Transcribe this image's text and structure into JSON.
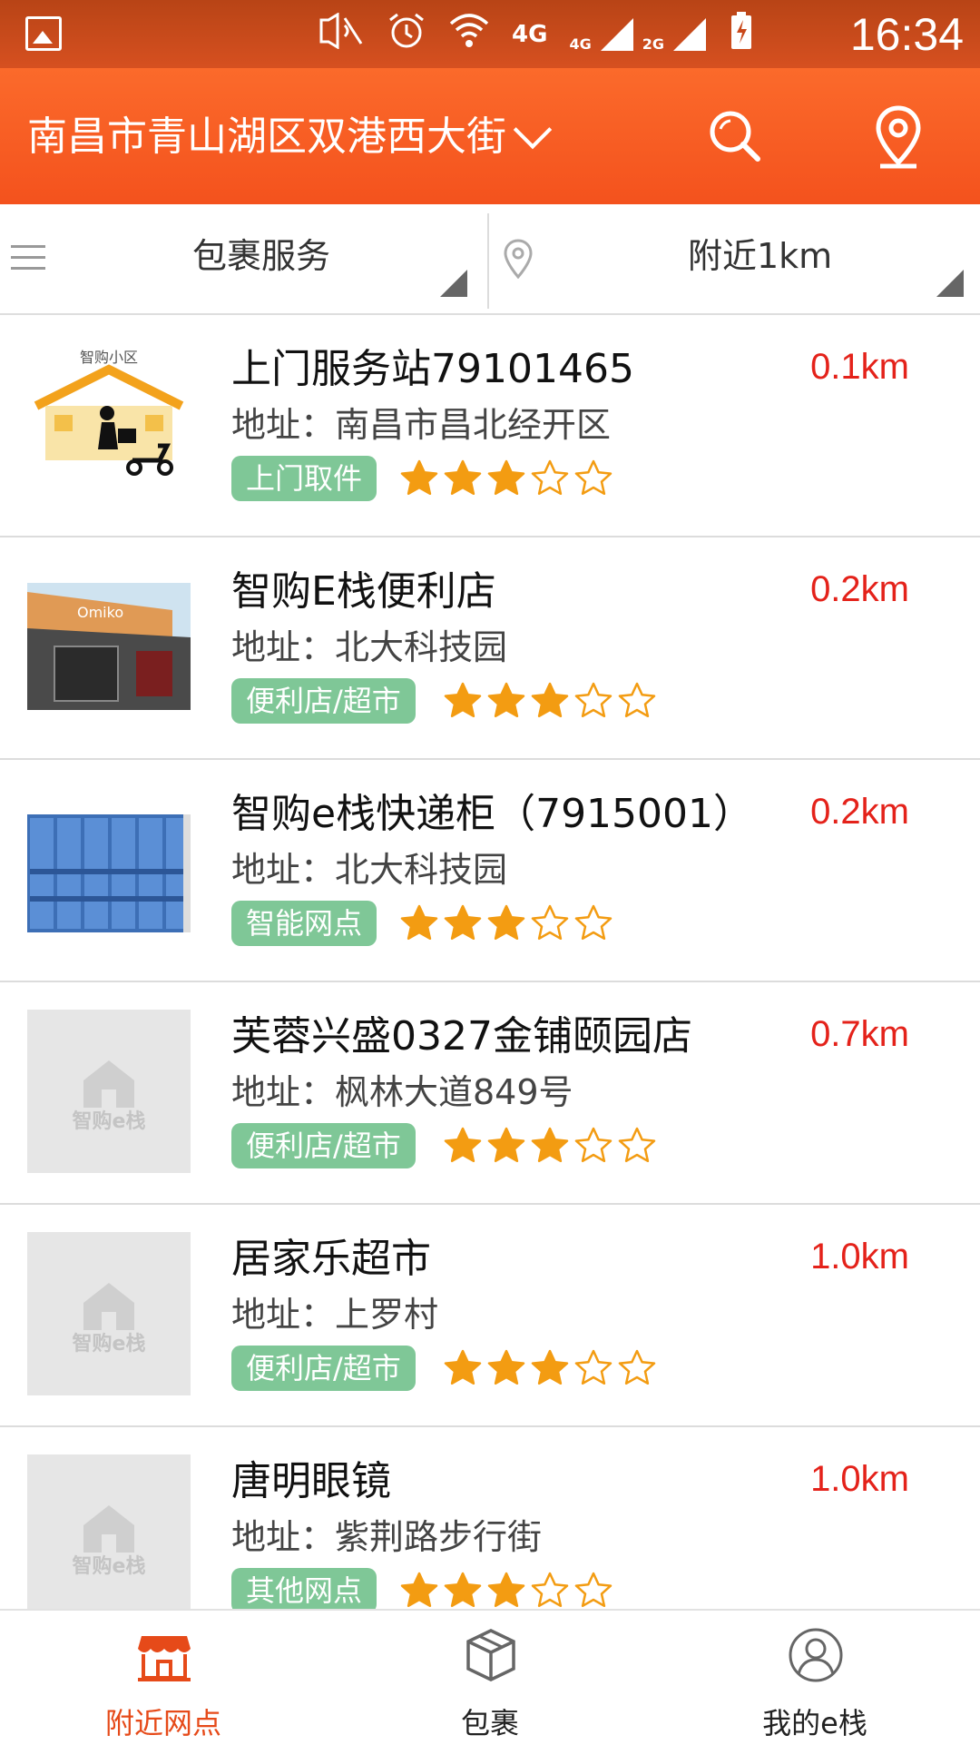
{
  "status_bar": {
    "time": "16:34",
    "network_1": "4G",
    "network_2": "4G",
    "network_3": "2G",
    "icons": [
      "image-icon",
      "mute-icon",
      "alarm-icon",
      "wifi-icon",
      "signal-icon",
      "battery-charging-icon"
    ]
  },
  "header": {
    "location": "南昌市青山湖区双港西大街",
    "accent_color": "#f75a22"
  },
  "filters": {
    "service_label": "包裹服务",
    "distance_label": "附近1km"
  },
  "stations": [
    {
      "name": "上门服务站79101465",
      "distance": "0.1km",
      "address": "地址：南昌市昌北经开区",
      "tag": "上门取件",
      "rating": 3,
      "thumb": "delivery-house-image",
      "thumb_caption": "智购小区"
    },
    {
      "name": "智购E栈便利店",
      "distance": "0.2km",
      "address": "地址：北大科技园",
      "tag": "便利店/超市",
      "rating": 3,
      "thumb": "storefront-image"
    },
    {
      "name": "智购e栈快递柜（7915001）",
      "distance": "0.2km",
      "address": "地址：北大科技园",
      "tag": "智能网点",
      "rating": 3,
      "thumb": "locker-image"
    },
    {
      "name": "芙蓉兴盛0327金铺颐园店",
      "distance": "0.7km",
      "address": "地址：枫林大道849号",
      "tag": "便利店/超市",
      "rating": 3,
      "thumb": "placeholder-logo",
      "thumb_caption": "智购e栈"
    },
    {
      "name": "居家乐超市",
      "distance": "1.0km",
      "address": "地址：上罗村",
      "tag": "便利店/超市",
      "rating": 3,
      "thumb": "placeholder-logo",
      "thumb_caption": "智购e栈"
    },
    {
      "name": "唐明眼镜",
      "distance": "1.0km",
      "address": "地址：紫荆路步行街",
      "tag": "其他网点",
      "rating": 3,
      "thumb": "placeholder-logo",
      "thumb_caption": "智购e栈"
    }
  ],
  "tabs": [
    {
      "label": "附近网点",
      "icon": "shop-icon",
      "active": true
    },
    {
      "label": "包裹",
      "icon": "package-icon",
      "active": false
    },
    {
      "label": "我的e栈",
      "icon": "user-icon",
      "active": false
    }
  ],
  "colors": {
    "distance": "#e4221a",
    "tag": "#7fc797",
    "star": "#f39c12",
    "active_tab": "#e64a19"
  }
}
